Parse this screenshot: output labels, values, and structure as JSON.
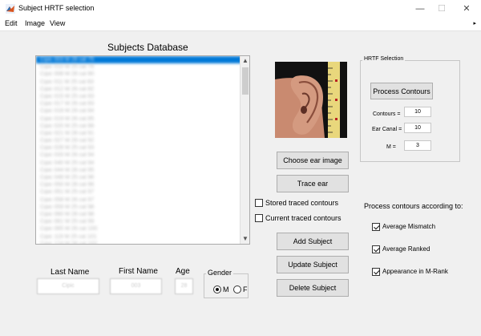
{
  "window": {
    "title": "Subject HRTF selection",
    "controls": {
      "minimize": "—",
      "maximize": "☐",
      "close": "✕"
    }
  },
  "menu": {
    "items": [
      "Edit",
      "Image",
      "View"
    ],
    "arrow": "▸"
  },
  "database": {
    "heading": "Subjects Database",
    "items": [
      "Cipic 003 M 28 cal 75",
      "Cipic 010 M 25 cal 76",
      "Cipic 008 M 28 cal 80",
      "Cipic 011 M 25 cal 83",
      "Cipic 012 M 26 cal 82",
      "Cipic 015 M 25 cal 83",
      "Cipic 017 M 26 cal 83",
      "Cipic 018 M 29 cal 84",
      "Cipic 019 M 26 cal 85",
      "Cipic 020 M 25 cal 88",
      "Cipic 021 M 28 cal 91",
      "Cipic 027 M 29 cal 92",
      "Cipic 028 M 25 cal 93",
      "Cipic 033 M 26 cal 94",
      "Cipic 040 M 25 cal 94",
      "Cipic 044 M 28 cal 95",
      "Cipic 048 M 25 cal 96",
      "Cipic 050 M 28 cal 96",
      "Cipic 051 M 25 cal 97",
      "Cipic 058 M 26 cal 97",
      "Cipic 059 M 25 cal 98",
      "Cipic 060 M 28 cal 98",
      "Cipic 061 M 25 cal 99",
      "Cipic 065 M 26 cal 100",
      "Cipic 119 M 25 cal 101",
      "Cipic 124 M 28 cal 102",
      "Cipic 126 M 25 cal 103"
    ],
    "selected_index": 0
  },
  "form": {
    "last_name_label": "Last Name",
    "first_name_label": "First Name",
    "age_label": "Age",
    "gender_label": "Gender",
    "last_name_value": "Cipic",
    "first_name_value": "003",
    "age_value": "28",
    "gender_options": [
      "M",
      "F"
    ],
    "gender_selected": "M"
  },
  "ear": {
    "choose_button": "Choose ear image",
    "trace_button": "Trace ear",
    "stored_contours_label": "Stored traced contours",
    "current_contours_label": "Current traced contours",
    "stored_checked": false,
    "current_checked": false
  },
  "actions": {
    "add": "Add Subject",
    "update": "Update Subject",
    "delete": "Delete Subject"
  },
  "hrtf": {
    "panel_label": "HRTF Selection",
    "process_button": "Process Contours",
    "contours_label": "Contours =",
    "contours_value": "10",
    "ear_canal_label": "Ear Canal =",
    "ear_canal_value": "10",
    "m_label": "M =",
    "m_value": "3",
    "criteria_heading": "Process contours according to:",
    "criteria": [
      {
        "label": "Average Mismatch",
        "checked": true
      },
      {
        "label": "Average Ranked",
        "checked": true
      },
      {
        "label": "Appearance in M-Rank",
        "checked": true
      }
    ]
  },
  "colors": {
    "selection": "#0078d7",
    "client_bg": "#f0f0f0",
    "button_bg": "#e1e1e1"
  }
}
